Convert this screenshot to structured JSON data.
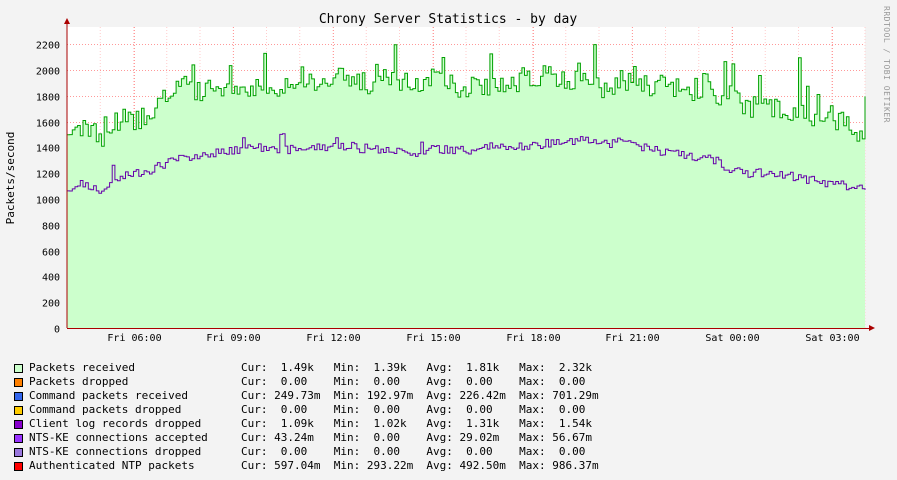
{
  "page": {
    "background": "#f3f3f3",
    "canvas": "#ffffff"
  },
  "vertical_text": "RRDTOOL / TOBI OETIKER",
  "chart_data": {
    "type": "area",
    "title": "Chrony Server Statistics - by day",
    "ylabel": "Packets/second",
    "xlabel": "",
    "ylim": [
      0,
      2350
    ],
    "y_ticks": [
      0,
      200,
      400,
      600,
      800,
      1000,
      1200,
      1400,
      1600,
      1800,
      2000,
      2200
    ],
    "x_range_hours": [
      4.0,
      28.0
    ],
    "x_ticks": [
      {
        "label": "Fri 06:00",
        "hour": 6
      },
      {
        "label": "Fri 09:00",
        "hour": 9
      },
      {
        "label": "Fri 12:00",
        "hour": 12
      },
      {
        "label": "Fri 15:00",
        "hour": 15
      },
      {
        "label": "Fri 18:00",
        "hour": 18
      },
      {
        "label": "Fri 21:00",
        "hour": 21
      },
      {
        "label": "Sat 00:00",
        "hour": 24
      },
      {
        "label": "Sat 03:00",
        "hour": 27
      }
    ],
    "grid": true,
    "colors": {
      "received_fill": "#ccffcc",
      "received_line": "#00a000",
      "client_log_line": "#6600aa",
      "grid": "#ff9999",
      "axis": "#aa0000"
    },
    "series": [
      {
        "name": "Packets received",
        "x": [
          4.0,
          4.5,
          5.0,
          5.5,
          6.0,
          6.5,
          7.0,
          7.5,
          8.0,
          8.5,
          9.0,
          9.5,
          10.0,
          10.5,
          11.0,
          11.5,
          12.0,
          12.5,
          13.0,
          13.5,
          14.0,
          14.5,
          15.0,
          15.5,
          16.0,
          16.5,
          17.0,
          17.5,
          18.0,
          18.5,
          19.0,
          19.5,
          20.0,
          20.5,
          21.0,
          21.5,
          22.0,
          22.5,
          23.0,
          23.5,
          24.0,
          24.5,
          25.0,
          25.5,
          26.0,
          26.5,
          27.0,
          27.5,
          28.0
        ],
        "values": [
          1500,
          1560,
          1470,
          1620,
          1600,
          1690,
          1800,
          1850,
          1820,
          1880,
          1830,
          1870,
          1900,
          1880,
          1950,
          1880,
          1930,
          1950,
          1900,
          1920,
          1880,
          1900,
          1960,
          1900,
          1860,
          1870,
          1900,
          1890,
          1920,
          1940,
          1900,
          2000,
          1870,
          1900,
          1950,
          1880,
          1870,
          1850,
          1850,
          1800,
          1800,
          1700,
          1720,
          1680,
          1700,
          1640,
          1640,
          1560,
          1480
        ]
      },
      {
        "name": "Client log records dropped",
        "x": [
          4.0,
          4.5,
          5.0,
          5.5,
          6.0,
          6.5,
          7.0,
          7.5,
          8.0,
          8.5,
          9.0,
          9.5,
          10.0,
          10.5,
          11.0,
          11.5,
          12.0,
          12.5,
          13.0,
          13.5,
          14.0,
          14.5,
          15.0,
          15.5,
          16.0,
          16.5,
          17.0,
          17.5,
          18.0,
          18.5,
          19.0,
          19.5,
          20.0,
          20.5,
          21.0,
          21.5,
          22.0,
          22.5,
          23.0,
          23.5,
          24.0,
          24.5,
          25.0,
          25.5,
          26.0,
          26.5,
          27.0,
          27.5,
          28.0
        ],
        "values": [
          1090,
          1100,
          1060,
          1150,
          1200,
          1230,
          1280,
          1320,
          1350,
          1360,
          1370,
          1400,
          1400,
          1380,
          1390,
          1400,
          1410,
          1400,
          1390,
          1380,
          1370,
          1360,
          1390,
          1380,
          1380,
          1400,
          1410,
          1400,
          1420,
          1430,
          1440,
          1460,
          1420,
          1440,
          1420,
          1400,
          1360,
          1340,
          1320,
          1300,
          1220,
          1200,
          1200,
          1180,
          1170,
          1140,
          1120,
          1100,
          1080
        ]
      }
    ]
  },
  "legend": [
    {
      "name": "Packets received",
      "color": "#ccffcc",
      "stats": "Cur:  1.49k   Min:  1.39k   Avg:  1.81k   Max:  2.32k"
    },
    {
      "name": "Packets dropped",
      "color": "#ff8000",
      "stats": "Cur:  0.00    Min:  0.00    Avg:  0.00    Max:  0.00"
    },
    {
      "name": "Command packets received",
      "color": "#3366ee",
      "stats": "Cur: 249.73m  Min: 192.97m  Avg: 226.42m  Max: 701.29m"
    },
    {
      "name": "Command packets dropped",
      "color": "#ffcc00",
      "stats": "Cur:  0.00    Min:  0.00    Avg:  0.00    Max:  0.00"
    },
    {
      "name": "Client log records dropped",
      "color": "#8800cc",
      "stats": "Cur:  1.09k   Min:  1.02k   Avg:  1.31k   Max:  1.54k"
    },
    {
      "name": "NTS-KE connections accepted",
      "color": "#9933ff",
      "stats": "Cur: 43.24m   Min:  0.00    Avg: 29.02m   Max: 56.67m"
    },
    {
      "name": "NTS-KE connections dropped",
      "color": "#9977dd",
      "stats": "Cur:  0.00    Min:  0.00    Avg:  0.00    Max:  0.00"
    },
    {
      "name": "Authenticated NTP packets",
      "color": "#ff0000",
      "stats": "Cur: 597.04m  Min: 293.22m  Avg: 492.50m  Max: 986.37m"
    }
  ]
}
